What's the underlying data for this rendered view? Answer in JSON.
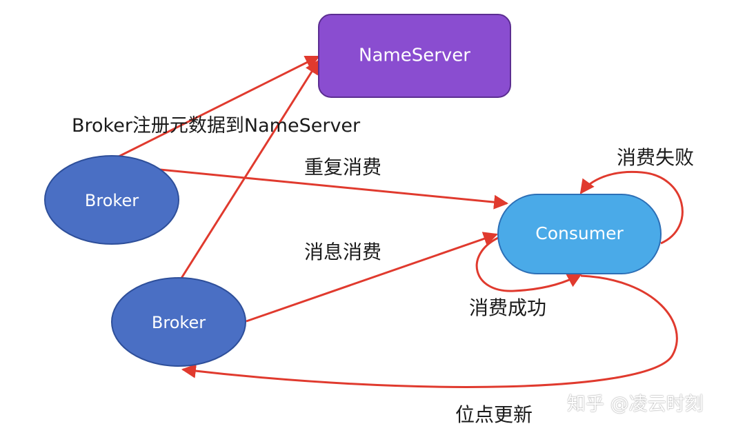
{
  "nodes": {
    "nameserver": {
      "label": "NameServer",
      "color": "#8a4dd0",
      "border": "#5b2d91"
    },
    "broker_top": {
      "label": "Broker",
      "color": "#4a6fc4",
      "border": "#2e4f9a"
    },
    "broker_bottom": {
      "label": "Broker",
      "color": "#4a6fc4",
      "border": "#2e4f9a"
    },
    "consumer": {
      "label": "Consumer",
      "color": "#4aaae8",
      "border": "#2c6fb6"
    }
  },
  "edges": {
    "register_label": "Broker注册元数据到NameServer",
    "repeat_consume_label": "重复消费",
    "message_consume_label": "消息消费",
    "consume_fail_label": "消费失败",
    "consume_success_label": "消费成功",
    "offset_update_label": "位点更新",
    "color": "#e03a2e"
  },
  "watermark": "知乎 @凌云时刻"
}
